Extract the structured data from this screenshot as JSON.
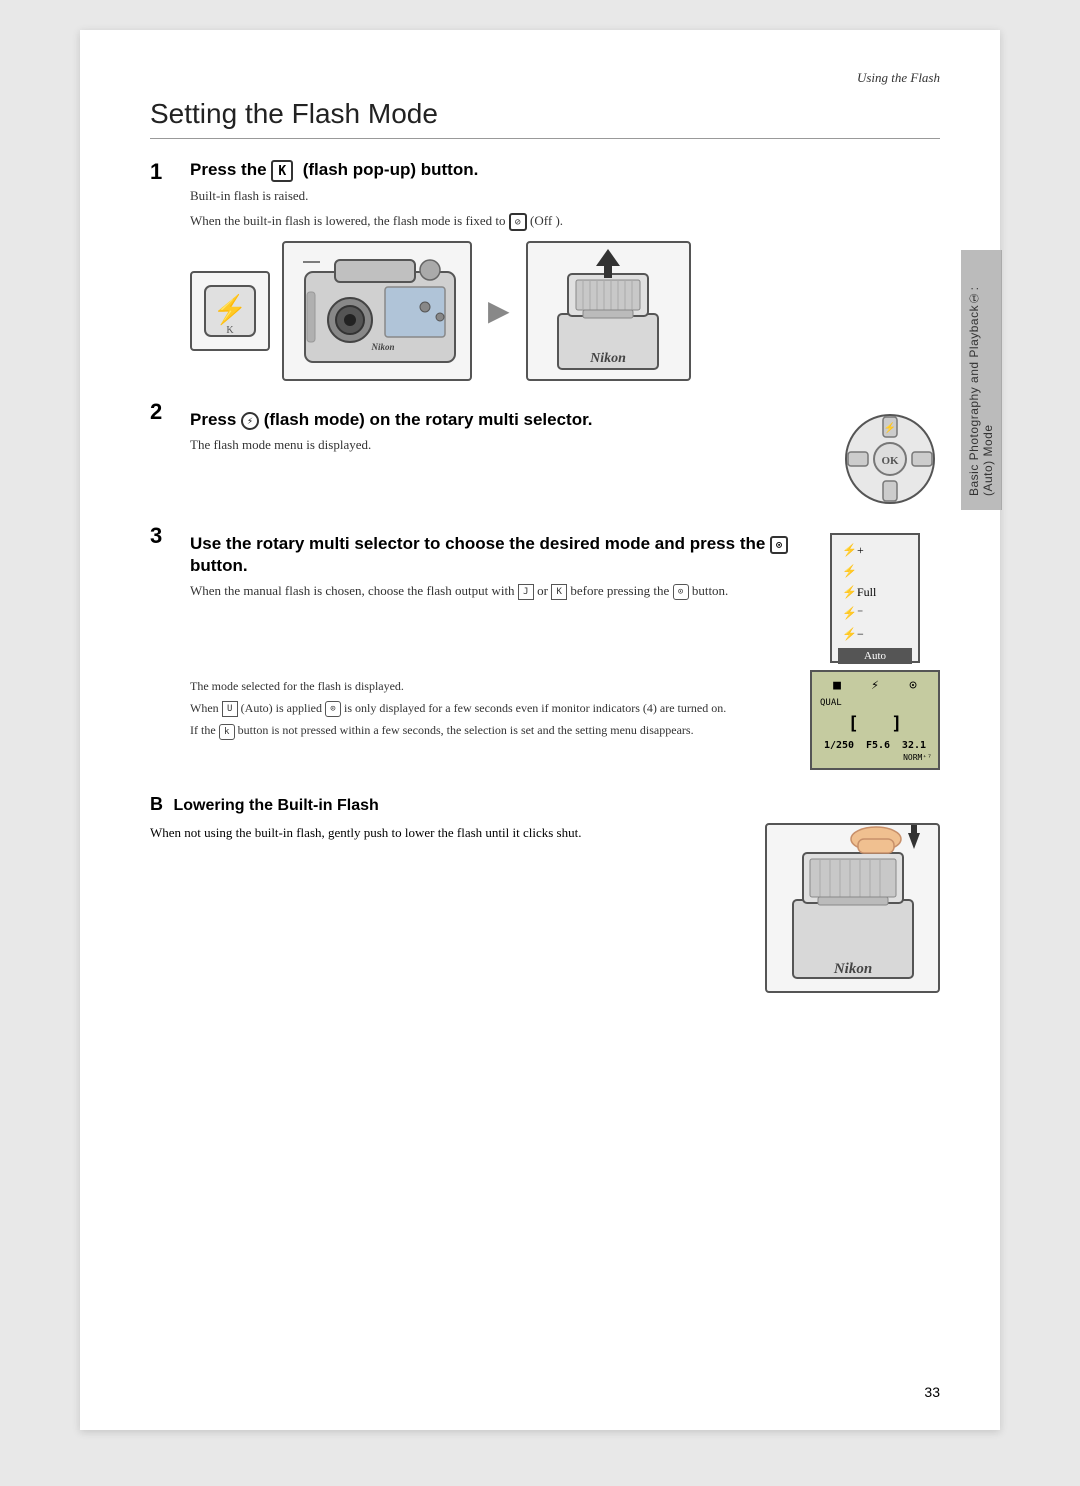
{
  "header": {
    "title": "Using the Flash"
  },
  "page": {
    "title": "Setting the Flash Mode"
  },
  "steps": [
    {
      "number": "1",
      "heading": "Press theⓀ (flash pop-up) button.",
      "notes": [
        "Built-in flash is raised.",
        "When the built-in flash is lowered, the flash mode is fixed to① (Off )."
      ]
    },
    {
      "number": "2",
      "heading": "Press① (flash mode) on the rotary multi selector.",
      "notes": [
        "The flash mode menu is displayed."
      ]
    },
    {
      "number": "3",
      "heading": "Use the rotary multi selector to choose the desired mode and press the① button.",
      "notes": [
        "When the manual flash is chosen, choose the flash output with ⓯ or Ⓚ before pressing the① button.",
        "The mode selected for the flash is displayed.",
        "When⓯ (Auto) is applied① is only displayed for a few seconds even if monitor indicators (4) are turned on.",
        "If theⓀ button is not pressed within a few seconds, the selection is set and the setting menu disappears."
      ]
    }
  ],
  "section_b": {
    "letter": "B",
    "heading": "Lowering the Built-in Flash",
    "text": "When not using the built-in flash, gently push to lower the flash until it clicks shut."
  },
  "sidebar": {
    "text": "Basic Photography and Playback①: (Auto) Mode"
  },
  "page_number": "33",
  "flash_menu": {
    "items": [
      "⚐⚡",
      "⚡",
      "⚡Full",
      "⚡⚡",
      "⚡−"
    ],
    "selected": "Auto"
  },
  "lcd": {
    "top_icons": [
      "■",
      "⚡",
      "☐"
    ],
    "center": "[ ]",
    "bottom": [
      "1/250",
      "F5.6",
      "32.1"
    ]
  }
}
